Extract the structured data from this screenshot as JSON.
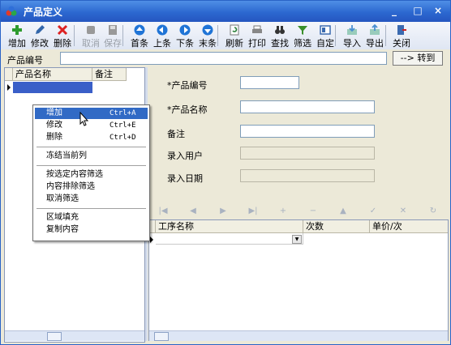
{
  "window": {
    "title": "产品定义",
    "controls": [
      "_",
      "□",
      "×"
    ]
  },
  "toolbar": [
    {
      "key": "add",
      "label": "增加",
      "icon": "plus-icon",
      "color": "#2e9b2e",
      "disabled": false
    },
    {
      "key": "edit",
      "label": "修改",
      "icon": "pencil-icon",
      "color": "#3366aa",
      "disabled": false
    },
    {
      "key": "delete",
      "label": "删除",
      "icon": "x-delete-icon",
      "color": "#d22",
      "disabled": false
    },
    {
      "key": "cancel",
      "label": "取消",
      "icon": "undo-icon",
      "color": "#999",
      "disabled": true
    },
    {
      "key": "save",
      "label": "保存",
      "icon": "save-icon",
      "color": "#999",
      "disabled": true
    },
    {
      "key": "first",
      "label": "首条",
      "icon": "arrow-up-icon",
      "color": "#1f74d6",
      "disabled": false
    },
    {
      "key": "prev",
      "label": "上条",
      "icon": "arrow-left-icon",
      "color": "#1f74d6",
      "disabled": false
    },
    {
      "key": "next",
      "label": "下条",
      "icon": "arrow-right-icon",
      "color": "#1f74d6",
      "disabled": false
    },
    {
      "key": "last",
      "label": "末条",
      "icon": "arrow-down-icon",
      "color": "#1f74d6",
      "disabled": false
    },
    {
      "key": "refresh",
      "label": "刷新",
      "icon": "refresh-icon",
      "color": "#2a7f3a",
      "disabled": false
    },
    {
      "key": "print",
      "label": "打印",
      "icon": "printer-icon",
      "color": "#555",
      "disabled": false
    },
    {
      "key": "find",
      "label": "查找",
      "icon": "binoculars-icon",
      "color": "#333",
      "disabled": false
    },
    {
      "key": "filter",
      "label": "筛选",
      "icon": "funnel-icon",
      "color": "#3a8f2a",
      "disabled": false
    },
    {
      "key": "custom",
      "label": "自定",
      "icon": "layout-icon",
      "color": "#3a6ab0",
      "disabled": false
    },
    {
      "key": "import",
      "label": "导入",
      "icon": "import-icon",
      "color": "#4a8fd0",
      "disabled": false
    },
    {
      "key": "export",
      "label": "导出",
      "icon": "export-icon",
      "color": "#4a8fd0",
      "disabled": false
    },
    {
      "key": "close",
      "label": "关闭",
      "icon": "exit-icon",
      "color": "#3a6ab0",
      "disabled": false
    }
  ],
  "codebar": {
    "label": "产品编号",
    "value": "",
    "goto_button": "--> 转到"
  },
  "left_table": {
    "columns": [
      "产品名称",
      "备注"
    ]
  },
  "form": {
    "product_code_label": "*产品编号",
    "product_name_label": "*产品名称",
    "remark_label": "备注",
    "entry_user_label": "录入用户",
    "entry_date_label": "录入日期",
    "product_code": "",
    "product_name": "",
    "remark": "",
    "entry_user": "",
    "entry_date": ""
  },
  "detail_grid": {
    "columns": [
      "工序名称",
      "次数",
      "单价/次"
    ]
  },
  "navigator": [
    "|◀",
    "◀",
    "▶",
    "▶|",
    "+",
    "−",
    "▲",
    "✓",
    "✕",
    "↻"
  ],
  "context_menu": [
    {
      "label": "增加",
      "shortcut": "Ctrl+A",
      "highlighted": true
    },
    {
      "label": "修改",
      "shortcut": "Ctrl+E",
      "highlighted": false
    },
    {
      "label": "删除",
      "shortcut": "Ctrl+D",
      "highlighted": false
    },
    {
      "separator": true
    },
    {
      "label": "冻结当前列",
      "shortcut": "",
      "highlighted": false
    },
    {
      "separator": true
    },
    {
      "label": "按选定内容筛选",
      "shortcut": "",
      "highlighted": false
    },
    {
      "label": "内容排除筛选",
      "shortcut": "",
      "highlighted": false
    },
    {
      "label": "取消筛选",
      "shortcut": "",
      "highlighted": false
    },
    {
      "separator": true
    },
    {
      "label": "区域填充",
      "shortcut": "",
      "highlighted": false
    },
    {
      "label": "复制内容",
      "shortcut": "",
      "highlighted": false
    }
  ]
}
